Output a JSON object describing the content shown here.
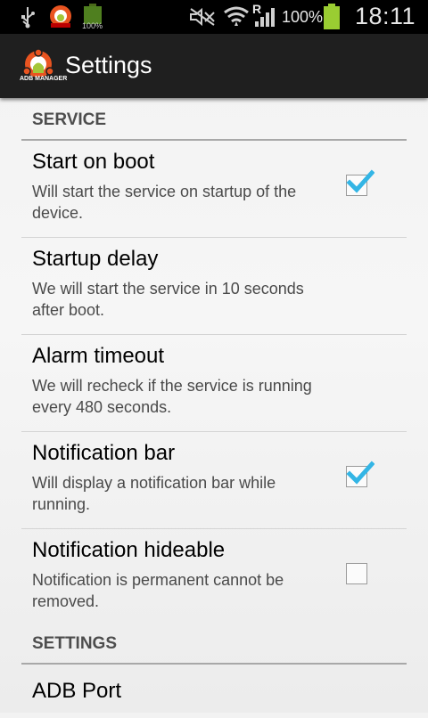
{
  "status_bar": {
    "icons": [
      "usb-icon",
      "app-notification-icon",
      "battery-notification-icon",
      "mute-icon",
      "wifi-icon",
      "signal-icon",
      "battery-icon"
    ],
    "battery_percent": "100%",
    "mini_battery_label": "100%",
    "roaming_indicator": "R",
    "time": "18:11"
  },
  "action_bar": {
    "title": "Settings",
    "logo_text": "ADB MANAGER"
  },
  "sections": [
    {
      "title": "SERVICE",
      "items": [
        {
          "title": "Start on boot",
          "summary": "Will start the service on startup of the device.",
          "checkbox": true,
          "checked": true
        },
        {
          "title": "Startup delay",
          "summary": "We will start the service in 10 seconds after boot.",
          "checkbox": false
        },
        {
          "title": "Alarm timeout",
          "summary": "We will recheck if the service is running every 480 seconds.",
          "checkbox": false
        },
        {
          "title": "Notification bar",
          "summary": "Will display a notification bar while running.",
          "checkbox": true,
          "checked": true
        },
        {
          "title": "Notification hideable",
          "summary": "Notification is permanent cannot be removed.",
          "checkbox": true,
          "checked": false
        }
      ]
    },
    {
      "title": "SETTINGS",
      "items": [
        {
          "title": "ADB Port"
        }
      ]
    }
  ],
  "colors": {
    "checkmark": "#33b5e5",
    "battery": "#9acd32",
    "logo_orange": "#e95420",
    "android_green": "#a4c639"
  }
}
